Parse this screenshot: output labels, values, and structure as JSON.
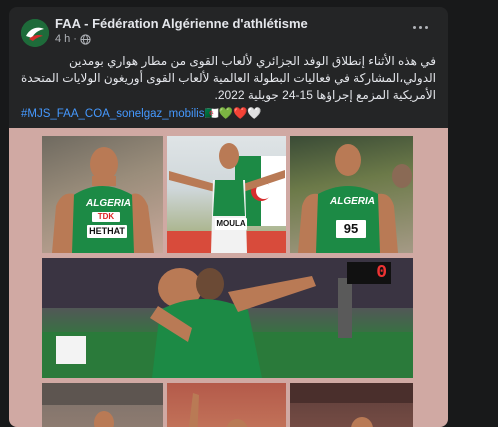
{
  "post": {
    "author": "FAA - Fédération Algérienne d'athlétisme",
    "time": "4 h",
    "text": "في هذه الأثناء إنطلاق الوفد الجزائري لألعاب القوى من مطار هواري بومدين الدولي،المشاركة في فعاليات البطولة العالمية لألعاب القوى أوريغون الولايات المتحدة الأمريكية المزمع إجراؤها 15-24 جويلية 2022.",
    "hashtags": "#MJS_FAA_COA_sonelgaz_mobilis",
    "emojis": "🇩🇿💚❤️🤍"
  },
  "photos": {
    "bib1_name": "HETHAT",
    "bib1_tag": "TDK",
    "bib2_name": "MOULA",
    "bib3_number": "95",
    "jersey_text": "ALGERIA",
    "scoreboard": "0"
  },
  "colors": {
    "card": "#242526",
    "link": "#4599ff",
    "gallery_bg": "#d0a9a3",
    "kit_green": "#1c8a45"
  },
  "icons": {
    "avatar": "faa-logo",
    "privacy": "globe-icon",
    "menu": "more-horizontal-icon"
  }
}
